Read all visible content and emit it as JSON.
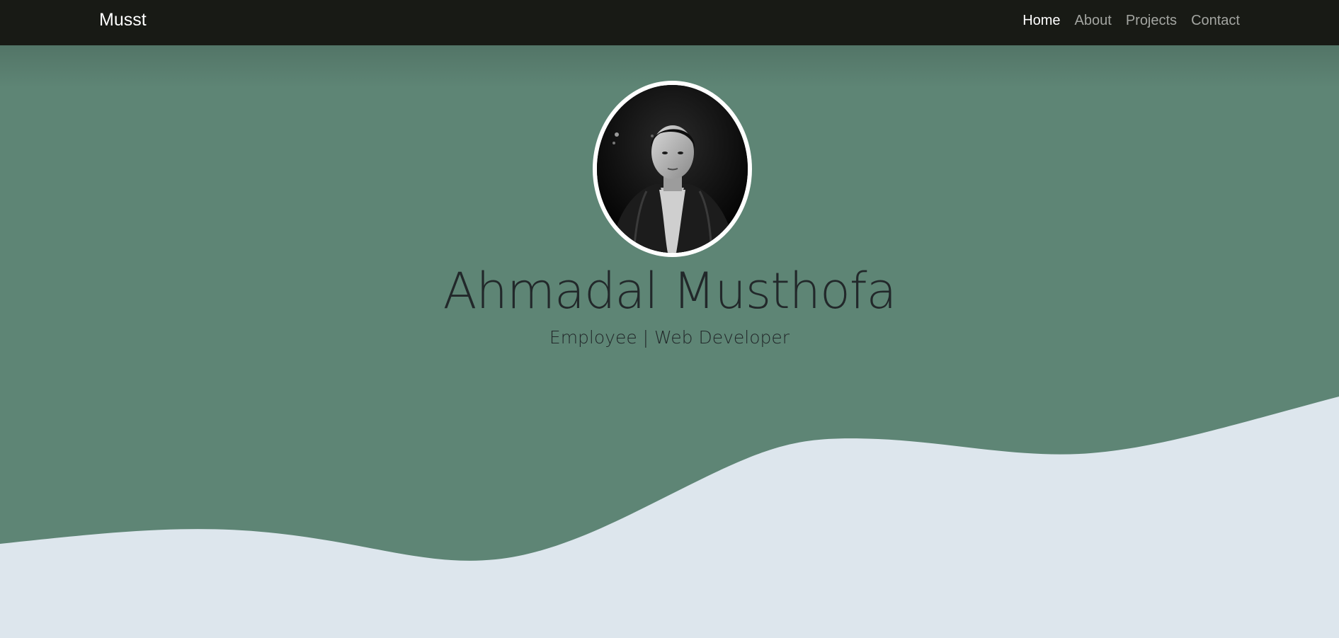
{
  "navbar": {
    "brand": "Musst",
    "links": [
      {
        "label": "Home",
        "active": true
      },
      {
        "label": "About",
        "active": false
      },
      {
        "label": "Projects",
        "active": false
      },
      {
        "label": "Contact",
        "active": false
      }
    ]
  },
  "hero": {
    "name": "Ahmadal Musthofa",
    "subtitle": "Employee | Web Developer",
    "avatar_icon": "profile-photo"
  },
  "colors": {
    "navbar_bg": "#181a15",
    "hero_bg": "#5e8575",
    "wave_bg": "#dde6ed",
    "text_dark": "#22282a",
    "nav_active": "#ffffff",
    "nav_inactive": "#a3a5a1"
  }
}
